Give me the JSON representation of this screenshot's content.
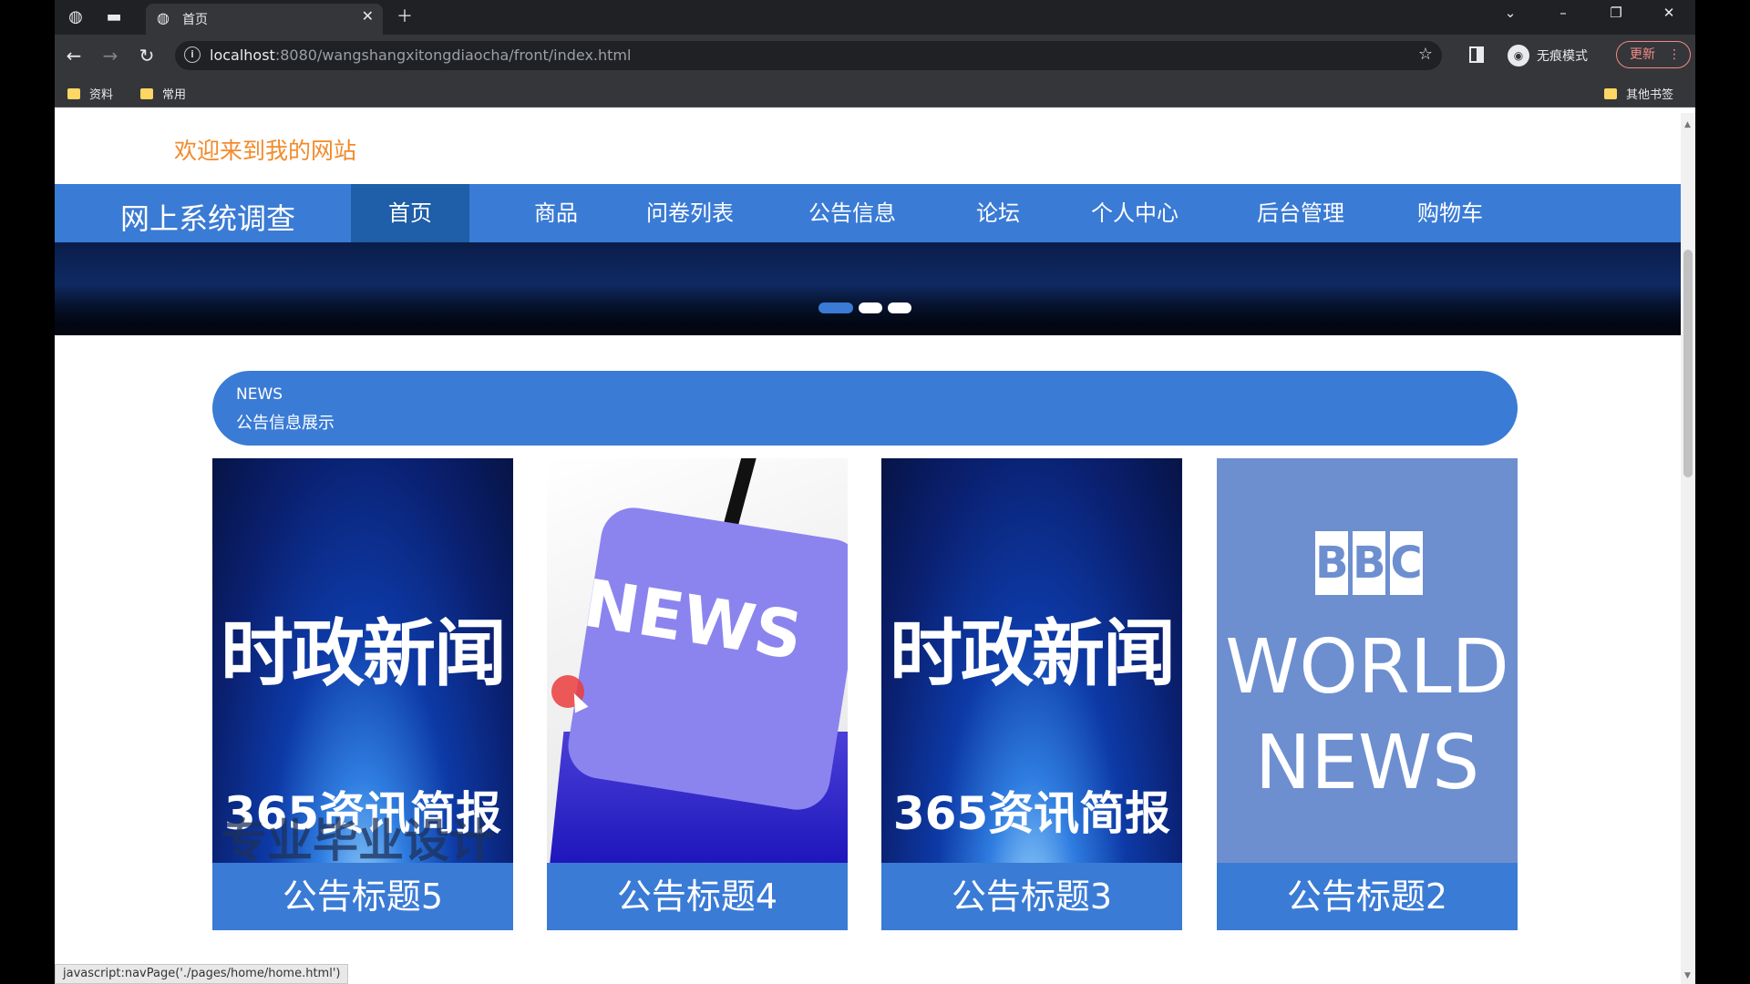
{
  "browser": {
    "tab_title": "首页",
    "url_host": "localhost",
    "url_rest": ":8080/wangshangxitongdiaocha/front/index.html",
    "incognito_label": "无痕模式",
    "update_label": "更新",
    "bookmarks": [
      "资料",
      "常用"
    ],
    "other_bookmarks": "其他书签",
    "status_url": "javascript:navPage('./pages/home/home.html')"
  },
  "page": {
    "welcome": "欢迎来到我的网站",
    "site_name": "网上系统调查",
    "nav": [
      "首页",
      "商品",
      "问卷列表",
      "公告信息",
      "论坛",
      "个人中心",
      "后台管理",
      "购物车"
    ],
    "active_nav": "首页",
    "news_en": "NEWS",
    "news_cn": "公告信息展示",
    "cards": [
      {
        "caption": "公告标题5",
        "image": "politics-news"
      },
      {
        "caption": "公告标题4",
        "image": "news-key"
      },
      {
        "caption": "公告标题3",
        "image": "politics-news"
      },
      {
        "caption": "公告标题2",
        "image": "bbc-world-news"
      }
    ],
    "image_text": {
      "politics_big": "时政新闻",
      "politics_sub": "365资讯简报",
      "watermark": "专业毕业设计",
      "news_key": "NEWS",
      "bbc_letters": [
        "B",
        "B",
        "C"
      ],
      "bbc_world": "WORLD",
      "bbc_news": "NEWS"
    }
  },
  "colors": {
    "primary": "#3a7bd5",
    "active_nav": "#1f5ea8",
    "welcome": "#f28a2b"
  }
}
